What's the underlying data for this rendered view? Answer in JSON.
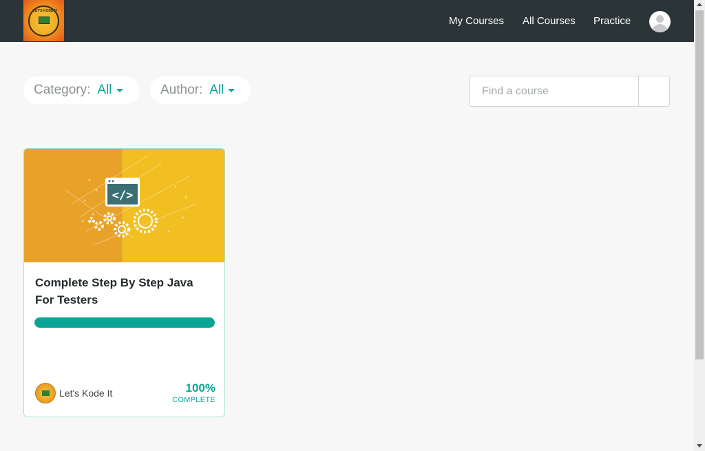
{
  "brand": {
    "logo_text": "LET'S KODE IT"
  },
  "nav": {
    "my_courses": "My Courses",
    "all_courses": "All Courses",
    "practice": "Practice"
  },
  "filters": {
    "category_label": "Category:",
    "category_value": "All",
    "author_label": "Author:",
    "author_value": "All"
  },
  "search": {
    "placeholder": "Find a course",
    "value": ""
  },
  "course": {
    "title": "Complete Step By Step Java For Testers",
    "progress_percent": 100,
    "percent_label": "100%",
    "complete_label": "COMPLETE",
    "author": "Let's Kode It",
    "image_code_symbol": "</>"
  },
  "colors": {
    "navbar": "#2b3537",
    "accent": "#0ba597",
    "course_image_left": "#e8a229",
    "course_image_right": "#f1bf22"
  },
  "icons": {
    "user": "user-avatar-icon",
    "search": "search-icon",
    "caret": "caret-down-icon"
  }
}
